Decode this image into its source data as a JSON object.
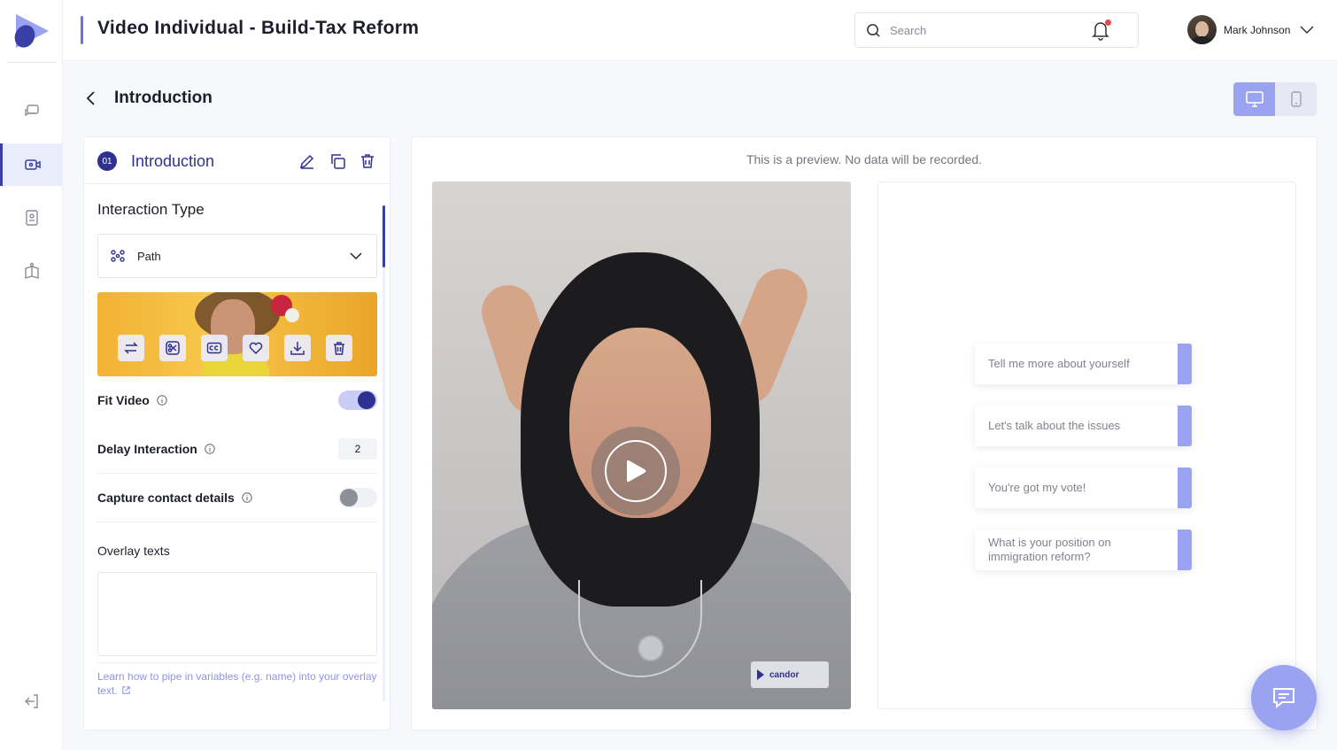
{
  "header": {
    "app_title": "Video Individual - Build-Tax Reform",
    "search_placeholder": "Search",
    "user_name": "Mark Johnson"
  },
  "sidebar": {
    "items": [
      {
        "icon": "chat-bubbles-icon",
        "active": false
      },
      {
        "icon": "video-camera-icon",
        "active": true
      },
      {
        "icon": "contact-book-icon",
        "active": false
      },
      {
        "icon": "open-book-icon",
        "active": false
      }
    ],
    "bottom_icon": "logout-icon"
  },
  "page": {
    "title": "Introduction",
    "device_toggle": {
      "active": "desktop",
      "options": [
        "desktop-icon",
        "mobile-icon"
      ]
    }
  },
  "step": {
    "number": "01",
    "title": "Introduction",
    "interaction_type_label": "Interaction Type",
    "interaction_type_value": "Path",
    "fit_video_label": "Fit Video",
    "fit_video_on": true,
    "delay_label": "Delay Interaction",
    "delay_value": "2",
    "capture_label": "Capture contact details",
    "capture_on": false,
    "overlay_label": "Overlay texts",
    "overlay_value": "",
    "help_text": "Learn how to pipe in variables (e.g. name) into your overlay text."
  },
  "preview": {
    "note": "This is a preview. No data will be recorded.",
    "watermark": "candor",
    "choices": [
      "Tell me more about yourself",
      "Let's talk about the issues",
      "You're got my vote!",
      "What is your position on immigration reform?"
    ]
  },
  "colors": {
    "accent": "#2f3190",
    "accent_light": "#9aa3f0",
    "background": "#f7f8fb"
  }
}
